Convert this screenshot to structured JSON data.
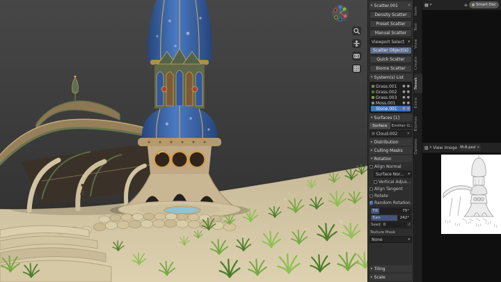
{
  "colors": {
    "accent": "#4772b3",
    "viewport_bg": "#3a3a3a",
    "panel_bg": "#2e2e2e",
    "editor_bg": "#0f0f0f",
    "sand": "#cfc2a0",
    "grass": "#5d8f35",
    "dome_blue": "#3f6db5"
  },
  "icons": {
    "chev_down": "▾",
    "chev_right": "▸",
    "close": "✕",
    "menu": "≡",
    "check": "✓",
    "dot": "●",
    "refresh": "↺",
    "grid": "▦",
    "image": "▨"
  },
  "scatter": {
    "emitter_tab": "Scatter.001",
    "create_buttons": [
      "Density Scatter",
      "Preset Scatter",
      "Manual Scatter"
    ],
    "select_dropdown": "Viewport Select",
    "primary_button": "Scatter Object(s)",
    "extra_buttons": [
      "Quick Scatter",
      "Biome Scatter"
    ],
    "systems": {
      "title": "System(s) List",
      "items": [
        {
          "name": "Grass.001"
        },
        {
          "name": "Grass.002"
        },
        {
          "name": "Grass.003"
        },
        {
          "name": "Moss.001"
        },
        {
          "name": "Stone.001"
        }
      ]
    },
    "surfaces": {
      "title": "Surfaces [1]",
      "mode_a": "Surface",
      "mode_b": "Emitter O..",
      "object": "Cloud.002"
    },
    "sections": {
      "distribution": {
        "label": "Distribution"
      },
      "culling": {
        "label": "Culling Masks"
      },
      "rotation": {
        "label": "Rotation"
      },
      "tiling": {
        "label": "Tiling"
      },
      "scale": {
        "label": "Scale"
      }
    },
    "rotation": {
      "align_normal": "Align Normal",
      "surface_normal": "Surface Nor...",
      "vertical_adj": "Vertical Adjust...",
      "align_tangent": "Align Tangent",
      "rotate": "Rotate",
      "random_rotation": "Random Rotation",
      "tilt_label": "Tilt",
      "tilt_value": "75°",
      "turn_label": "Turn",
      "turn_value": "242°",
      "seed_label": "Seed",
      "seed_value": "0",
      "texture_mask_label": "Texture Mask",
      "texture_mask_value": "None"
    }
  },
  "tabs": [
    "Item",
    "Tool",
    "View",
    "Create",
    "Tweak",
    "Extra",
    "Biomes",
    "Options"
  ],
  "image_editor": {
    "smart_button": "Smart Doc",
    "menu_view": "View",
    "menu_image": "Image",
    "datablock": "M-8.psd"
  }
}
